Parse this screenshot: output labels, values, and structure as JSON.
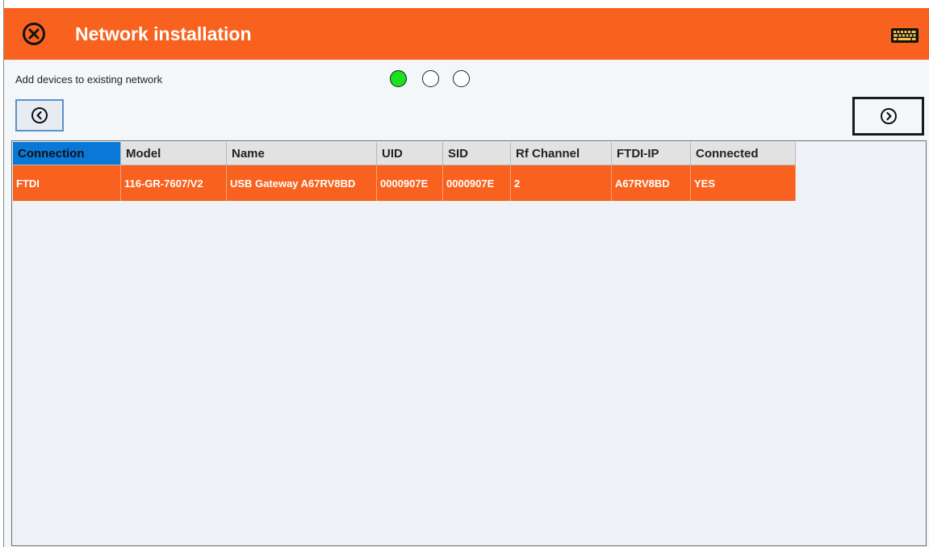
{
  "window": {
    "title": "Network installation",
    "accent_color": "#f8621e",
    "close_icon": "close-circle-icon",
    "keyboard_icon": "keyboard-icon"
  },
  "wizard": {
    "step_label": "Add devices to existing network",
    "steps": [
      {
        "active": true
      },
      {
        "active": false
      },
      {
        "active": false
      }
    ],
    "active_step_color": "#1be11e",
    "back_icon": "chevron-left-circle-icon",
    "next_icon": "chevron-right-circle-icon"
  },
  "table": {
    "columns": [
      "Connection",
      "Model",
      "Name",
      "UID",
      "SID",
      "Rf Channel",
      "FTDI-IP",
      "Connected"
    ],
    "selected_column": "Connection",
    "rows": [
      [
        "FTDI",
        "116-GR-7607/V2",
        "USB Gateway A67RV8BD",
        "0000907E",
        "0000907E",
        "2",
        "A67RV8BD",
        "YES"
      ]
    ],
    "selected_row_color": "#f8621e",
    "header_highlight_color": "#0a78d7"
  }
}
